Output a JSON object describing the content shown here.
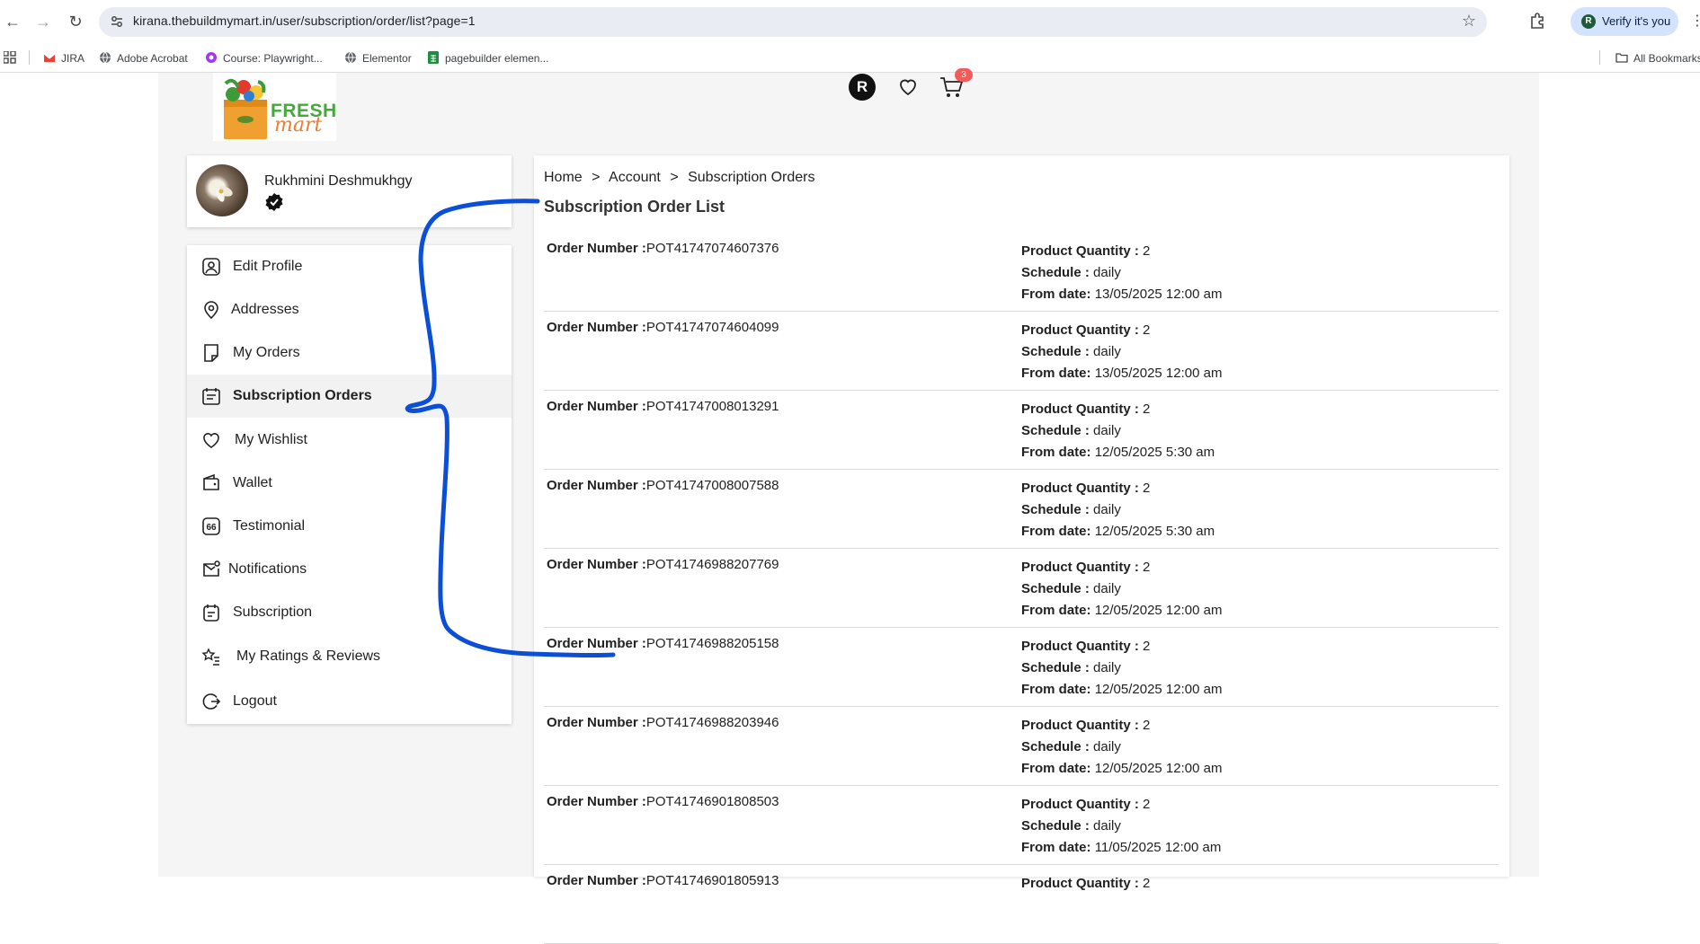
{
  "browser": {
    "url": "kirana.thebuildmymart.in/user/subscription/order/list?page=1",
    "verify_label": "Verify it's you",
    "profile_initial": "R",
    "bookmarks": [
      "JIRA",
      "Adobe Acrobat",
      "Course: Playwright...",
      "Elementor",
      "pagebuilder elemen..."
    ],
    "all_bookmarks": "All Bookmarks"
  },
  "header": {
    "logo_line1": "FRESH",
    "logo_line2": "mart",
    "user_initial": "R",
    "cart_count": "3"
  },
  "profile": {
    "name": "Rukhmini Deshmukhgy"
  },
  "menu": [
    {
      "label": "Edit Profile",
      "icon": "user-icon"
    },
    {
      "label": "Addresses",
      "icon": "location-pin-icon"
    },
    {
      "label": "My Orders",
      "icon": "orders-icon"
    },
    {
      "label": "Subscription Orders",
      "icon": "subscription-orders-icon",
      "active": true
    },
    {
      "label": "My Wishlist",
      "icon": "heart-icon"
    },
    {
      "label": "Wallet",
      "icon": "wallet-icon"
    },
    {
      "label": "Testimonial",
      "icon": "quote-icon"
    },
    {
      "label": "Notifications",
      "icon": "mail-notification-icon"
    },
    {
      "label": "Subscription",
      "icon": "subscription-icon"
    },
    {
      "label": "My Ratings & Reviews",
      "icon": "star-list-icon"
    },
    {
      "label": "Logout",
      "icon": "logout-icon"
    }
  ],
  "breadcrumb": {
    "home": "Home",
    "sep": ">",
    "account": "Account",
    "current": "Subscription Orders"
  },
  "list_title": "Subscription Order List",
  "labels": {
    "order_number": "Order Number :",
    "product_quantity": "Product Quantity :",
    "schedule": "Schedule :",
    "from_date": "From date:"
  },
  "orders": [
    {
      "number": "POT41747074607376",
      "quantity": "2",
      "schedule": "daily",
      "from_date": "13/05/2025 12:00 am"
    },
    {
      "number": "POT41747074604099",
      "quantity": "2",
      "schedule": "daily",
      "from_date": "13/05/2025 12:00 am"
    },
    {
      "number": "POT41747008013291",
      "quantity": "2",
      "schedule": "daily",
      "from_date": "12/05/2025 5:30 am"
    },
    {
      "number": "POT41747008007588",
      "quantity": "2",
      "schedule": "daily",
      "from_date": "12/05/2025 5:30 am"
    },
    {
      "number": "POT41746988207769",
      "quantity": "2",
      "schedule": "daily",
      "from_date": "12/05/2025 12:00 am"
    },
    {
      "number": "POT41746988205158",
      "quantity": "2",
      "schedule": "daily",
      "from_date": "12/05/2025 12:00 am"
    },
    {
      "number": "POT41746988203946",
      "quantity": "2",
      "schedule": "daily",
      "from_date": "12/05/2025 12:00 am"
    },
    {
      "number": "POT41746901808503",
      "quantity": "2",
      "schedule": "daily",
      "from_date": "11/05/2025 12:00 am"
    },
    {
      "number": "POT41746901805913",
      "quantity": "2",
      "schedule": "",
      "from_date": ""
    }
  ],
  "colors": {
    "annotation": "#0b4fd6",
    "badge": "#f25a5a",
    "logo_green": "#45a83b",
    "logo_orange": "#ef7d2c"
  }
}
